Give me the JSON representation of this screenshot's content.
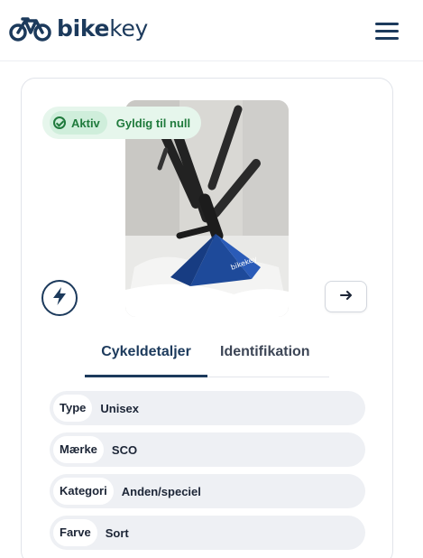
{
  "header": {
    "logo_bold": "bike",
    "logo_light": "key",
    "logo_icon": "bicycle-icon",
    "menu_icon": "hamburger-icon"
  },
  "status": {
    "active_label": "Aktiv",
    "validity_label": "Gyldig til null",
    "color": "#1f7a3c"
  },
  "photo": {
    "stand_brand": "bikekey"
  },
  "actions": {
    "left_icon": "lightning-bolt-icon",
    "right_icon": "arrow-right-icon"
  },
  "tabs": [
    {
      "label": "Cykeldetaljer",
      "active": true
    },
    {
      "label": "Identifikation",
      "active": false
    }
  ],
  "details": [
    {
      "key": "Type",
      "value": "Unisex"
    },
    {
      "key": "Mærke",
      "value": "SCO"
    },
    {
      "key": "Kategori",
      "value": "Anden/speciel"
    },
    {
      "key": "Farve",
      "value": "Sort"
    }
  ],
  "colors": {
    "brand": "#1c3a5c",
    "badge_bg": "#e6f6ec",
    "row_bg": "#eef0f4"
  }
}
